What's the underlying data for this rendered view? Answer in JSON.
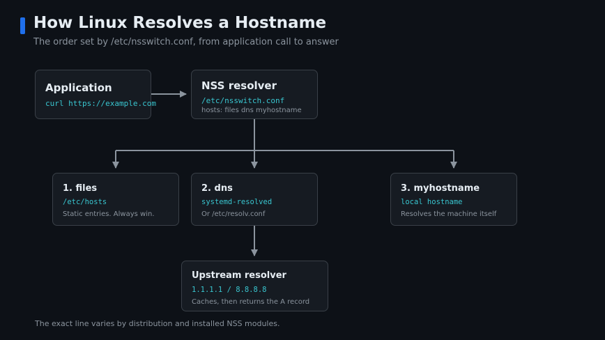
{
  "header": {
    "title": "How Linux Resolves a Hostname",
    "subtitle": "The order set by /etc/nsswitch.conf, from application call to answer"
  },
  "nodes": {
    "application": {
      "title": "Application",
      "code": "curl https://example.com"
    },
    "nss": {
      "title": "NSS resolver",
      "code": "/etc/nsswitch.conf",
      "desc": "hosts: files dns myhostname"
    },
    "files": {
      "title": "1. files",
      "code": "/etc/hosts",
      "desc": "Static entries. Always win."
    },
    "dns": {
      "title": "2. dns",
      "code": "systemd-resolved",
      "desc": "Or /etc/resolv.conf"
    },
    "myhostname": {
      "title": "3. myhostname",
      "code": "local hostname",
      "desc": "Resolves the machine itself"
    },
    "upstream": {
      "title": "Upstream resolver",
      "code": "1.1.1.1 / 8.8.8.8",
      "desc": "Caches, then returns the A record"
    }
  },
  "footer": {
    "note": "The exact line varies by distribution and installed NSS modules."
  },
  "colors": {
    "background": "#0d1117",
    "card": "#161b22",
    "border": "#3a4048",
    "accent": "#1f6feb",
    "code": "#39c5cf",
    "connector": "#8b949e",
    "text": "#e6edf3",
    "muted": "#8b949e"
  }
}
